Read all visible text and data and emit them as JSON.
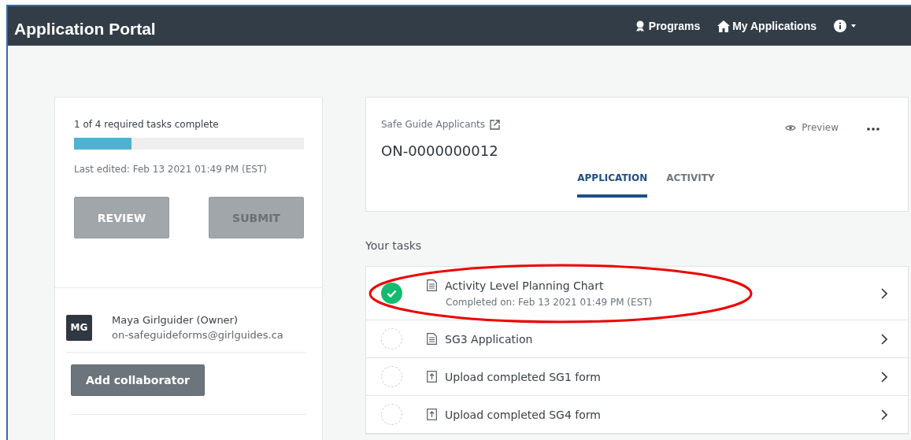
{
  "header": {
    "title": "Application Portal",
    "nav": [
      {
        "label": "Programs",
        "kind": "programs"
      },
      {
        "label": "My Applications",
        "kind": "home"
      }
    ]
  },
  "summary": {
    "progress_text": "1 of 4 required tasks complete",
    "level": 0.25,
    "last_edited": "Last edited: Feb 13 2021 01:49 PM (EST)",
    "buttons": [
      {
        "label": "REVIEW",
        "disabled": false
      },
      {
        "label": "SUBMIT",
        "disabled": true
      }
    ]
  },
  "collaborator": {
    "initials": "MG",
    "name": "Maya Girlguider (Owner)",
    "email": "on-safeguideforms@girlguides.ca",
    "button": "Add collaborator"
  },
  "application": {
    "program": "Safe Guide Applicants",
    "preview": "Preview",
    "number": "ON-0000000012",
    "tabs": [
      {
        "label": "APPLICATION",
        "selected": true
      },
      {
        "label": "ACTIVITY",
        "selected": false
      }
    ]
  },
  "tasks_heading": "Your tasks",
  "tasks": [
    {
      "kind": "form",
      "title": "Activity Level Planning Chart",
      "subtitle": "Completed on: Feb 13 2021 01:49 PM (EST)",
      "completed": true,
      "highlighted": true
    },
    {
      "kind": "form",
      "title": "SG3 Application",
      "completed": false,
      "highlighted": false
    },
    {
      "kind": "upload",
      "title": "Upload completed SG1 form",
      "completed": false,
      "highlighted": false
    },
    {
      "kind": "upload",
      "title": "Upload completed SG4 form",
      "completed": false,
      "highlighted": false
    }
  ]
}
